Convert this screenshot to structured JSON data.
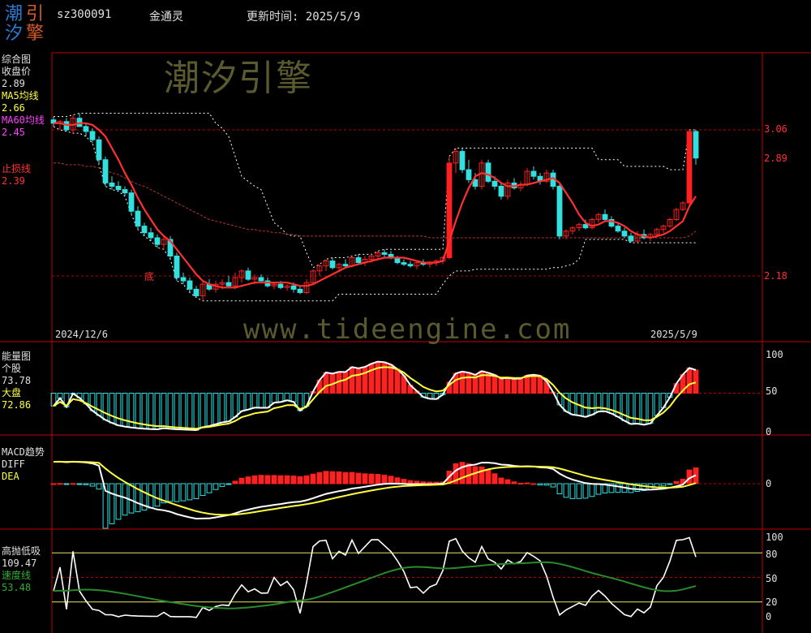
{
  "header": {
    "logo_chars": [
      "潮",
      "引",
      "汐",
      "擎"
    ],
    "code": "sz300091",
    "indicator_name": "金通灵",
    "update_label": "更新时间: 2025/5/9"
  },
  "watermarks": {
    "top": "潮汐引擎",
    "middle": "www.tideengine.com"
  },
  "colors": {
    "up": "#ff2020",
    "down": "#33e0e0",
    "border": "#c00000",
    "ma5": "#ffff40",
    "ma60": "#ff40ff",
    "stop": "#ff3030",
    "green": "#2a8a2a"
  },
  "panels": {
    "main": {
      "title": "综合图",
      "close_label": "收盘价",
      "close_value": "2.89",
      "ma5_label": "MA5均线",
      "ma5_value": "2.66",
      "ma60_label": "MA60均线",
      "ma60_value": "2.45",
      "stop_label": "止损线",
      "stop_value": "2.39",
      "bottom_marker": "底",
      "date_start": "2024/12/6",
      "date_end": "2025/5/9",
      "price_ticks": [
        "3.06",
        "2.89",
        "2.18"
      ]
    },
    "energy": {
      "title": "能量图",
      "stock_label": "个股",
      "stock_value": "73.78",
      "market_label": "大盘",
      "market_value": "72.86",
      "ticks": [
        "100",
        "50",
        "0"
      ]
    },
    "macd": {
      "title": "MACD趋势",
      "diff_label": "DIFF",
      "dea_label": "DEA",
      "ticks": [
        "0"
      ]
    },
    "tide": {
      "title": "高抛低吸",
      "value1": "109.47",
      "speed_label": "速度线",
      "value2": "53.48",
      "ticks": [
        "100",
        "80",
        "50",
        "20",
        "0"
      ]
    }
  },
  "chart_data": {
    "type": "candlestick",
    "dates_shown": [
      "2024/12/6",
      "2025/5/9"
    ],
    "candles": [
      [
        3.12,
        3.14,
        3.08,
        3.1
      ],
      [
        3.1,
        3.12,
        3.06,
        3.11
      ],
      [
        3.11,
        3.13,
        3.05,
        3.06
      ],
      [
        3.06,
        3.15,
        3.04,
        3.13
      ],
      [
        3.13,
        3.16,
        3.08,
        3.08
      ],
      [
        3.08,
        3.1,
        3.02,
        3.05
      ],
      [
        3.05,
        3.07,
        2.98,
        3.0
      ],
      [
        3.0,
        3.02,
        2.85,
        2.88
      ],
      [
        2.88,
        2.9,
        2.72,
        2.74
      ],
      [
        2.74,
        2.78,
        2.7,
        2.72
      ],
      [
        2.72,
        2.75,
        2.69,
        2.7
      ],
      [
        2.7,
        2.72,
        2.66,
        2.68
      ],
      [
        2.68,
        2.7,
        2.55,
        2.57
      ],
      [
        2.57,
        2.6,
        2.46,
        2.48
      ],
      [
        2.48,
        2.5,
        2.42,
        2.44
      ],
      [
        2.44,
        2.47,
        2.39,
        2.41
      ],
      [
        2.41,
        2.43,
        2.35,
        2.37
      ],
      [
        2.37,
        2.42,
        2.34,
        2.4
      ],
      [
        2.4,
        2.42,
        2.28,
        2.3
      ],
      [
        2.3,
        2.32,
        2.15,
        2.17
      ],
      [
        2.17,
        2.2,
        2.13,
        2.15
      ],
      [
        2.15,
        2.17,
        2.08,
        2.1
      ],
      [
        2.1,
        2.12,
        2.05,
        2.06
      ],
      [
        2.06,
        2.15,
        2.03,
        2.13
      ],
      [
        2.13,
        2.16,
        2.09,
        2.1
      ],
      [
        2.1,
        2.15,
        2.08,
        2.13
      ],
      [
        2.13,
        2.16,
        2.1,
        2.14
      ],
      [
        2.14,
        2.18,
        2.11,
        2.12
      ],
      [
        2.12,
        2.2,
        2.1,
        2.17
      ],
      [
        2.17,
        2.22,
        2.14,
        2.21
      ],
      [
        2.21,
        2.23,
        2.15,
        2.16
      ],
      [
        2.16,
        2.19,
        2.13,
        2.17
      ],
      [
        2.17,
        2.19,
        2.14,
        2.15
      ],
      [
        2.15,
        2.17,
        2.11,
        2.12
      ],
      [
        2.12,
        2.14,
        2.1,
        2.13
      ],
      [
        2.13,
        2.15,
        2.1,
        2.11
      ],
      [
        2.11,
        2.13,
        2.09,
        2.12
      ],
      [
        2.12,
        2.14,
        2.08,
        2.1
      ],
      [
        2.1,
        2.12,
        2.07,
        2.08
      ],
      [
        2.08,
        2.16,
        2.07,
        2.14
      ],
      [
        2.14,
        2.22,
        2.13,
        2.21
      ],
      [
        2.21,
        2.25,
        2.18,
        2.24
      ],
      [
        2.24,
        2.28,
        2.21,
        2.27
      ],
      [
        2.27,
        2.29,
        2.22,
        2.23
      ],
      [
        2.23,
        2.26,
        2.21,
        2.25
      ],
      [
        2.25,
        2.28,
        2.23,
        2.24
      ],
      [
        2.24,
        2.3,
        2.23,
        2.29
      ],
      [
        2.29,
        2.31,
        2.25,
        2.26
      ],
      [
        2.26,
        2.3,
        2.24,
        2.28
      ],
      [
        2.28,
        2.31,
        2.26,
        2.3
      ],
      [
        2.3,
        2.33,
        2.28,
        2.32
      ],
      [
        2.32,
        2.34,
        2.29,
        2.31
      ],
      [
        2.31,
        2.33,
        2.28,
        2.29
      ],
      [
        2.29,
        2.3,
        2.25,
        2.26
      ],
      [
        2.26,
        2.28,
        2.24,
        2.25
      ],
      [
        2.25,
        2.27,
        2.23,
        2.24
      ],
      [
        2.24,
        2.27,
        2.22,
        2.26
      ],
      [
        2.26,
        2.28,
        2.24,
        2.25
      ],
      [
        2.25,
        2.27,
        2.23,
        2.26
      ],
      [
        2.26,
        2.28,
        2.24,
        2.27
      ],
      [
        2.27,
        2.3,
        2.25,
        2.29
      ],
      [
        2.29,
        2.9,
        2.28,
        2.86
      ],
      [
        2.86,
        2.95,
        2.8,
        2.93
      ],
      [
        2.93,
        2.95,
        2.8,
        2.82
      ],
      [
        2.82,
        2.88,
        2.74,
        2.76
      ],
      [
        2.76,
        2.8,
        2.7,
        2.72
      ],
      [
        2.72,
        2.88,
        2.7,
        2.86
      ],
      [
        2.86,
        2.88,
        2.74,
        2.75
      ],
      [
        2.75,
        2.78,
        2.7,
        2.72
      ],
      [
        2.72,
        2.74,
        2.64,
        2.66
      ],
      [
        2.66,
        2.76,
        2.64,
        2.74
      ],
      [
        2.74,
        2.77,
        2.7,
        2.71
      ],
      [
        2.71,
        2.75,
        2.69,
        2.73
      ],
      [
        2.73,
        2.83,
        2.72,
        2.81
      ],
      [
        2.81,
        2.84,
        2.76,
        2.78
      ],
      [
        2.78,
        2.8,
        2.73,
        2.75
      ],
      [
        2.75,
        2.82,
        2.74,
        2.8
      ],
      [
        2.8,
        2.82,
        2.7,
        2.72
      ],
      [
        2.72,
        2.74,
        2.4,
        2.42
      ],
      [
        2.42,
        2.46,
        2.4,
        2.45
      ],
      [
        2.45,
        2.48,
        2.43,
        2.47
      ],
      [
        2.47,
        2.5,
        2.45,
        2.49
      ],
      [
        2.49,
        2.52,
        2.46,
        2.47
      ],
      [
        2.47,
        2.53,
        2.46,
        2.52
      ],
      [
        2.52,
        2.56,
        2.5,
        2.55
      ],
      [
        2.55,
        2.58,
        2.51,
        2.52
      ],
      [
        2.52,
        2.54,
        2.47,
        2.48
      ],
      [
        2.48,
        2.5,
        2.44,
        2.45
      ],
      [
        2.45,
        2.47,
        2.41,
        2.42
      ],
      [
        2.42,
        2.44,
        2.38,
        2.39
      ],
      [
        2.39,
        2.45,
        2.38,
        2.43
      ],
      [
        2.43,
        2.46,
        2.4,
        2.41
      ],
      [
        2.41,
        2.44,
        2.39,
        2.43
      ],
      [
        2.43,
        2.47,
        2.42,
        2.46
      ],
      [
        2.46,
        2.49,
        2.44,
        2.48
      ],
      [
        2.48,
        2.53,
        2.47,
        2.52
      ],
      [
        2.52,
        2.59,
        2.51,
        2.58
      ],
      [
        2.58,
        2.63,
        2.57,
        2.62
      ],
      [
        2.62,
        3.06,
        2.6,
        3.05
      ],
      [
        3.05,
        3.06,
        2.85,
        2.89
      ]
    ],
    "ma5": [
      3.1,
      3.1,
      3.09,
      3.09,
      3.1,
      3.1,
      3.09,
      3.06,
      3.02,
      2.95,
      2.88,
      2.8,
      2.73,
      2.65,
      2.58,
      2.52,
      2.46,
      2.42,
      2.39,
      2.34,
      2.29,
      2.24,
      2.19,
      2.15,
      2.13,
      2.12,
      2.11,
      2.11,
      2.11,
      2.12,
      2.13,
      2.14,
      2.14,
      2.14,
      2.14,
      2.14,
      2.14,
      2.13,
      2.12,
      2.12,
      2.13,
      2.15,
      2.17,
      2.19,
      2.21,
      2.23,
      2.24,
      2.25,
      2.26,
      2.27,
      2.28,
      2.29,
      2.29,
      2.29,
      2.29,
      2.28,
      2.27,
      2.26,
      2.26,
      2.26,
      2.27,
      2.39,
      2.51,
      2.62,
      2.71,
      2.78,
      2.8,
      2.79,
      2.77,
      2.74,
      2.72,
      2.72,
      2.73,
      2.73,
      2.74,
      2.75,
      2.76,
      2.77,
      2.74,
      2.68,
      2.62,
      2.55,
      2.5,
      2.48,
      2.49,
      2.51,
      2.51,
      2.5,
      2.48,
      2.45,
      2.43,
      2.42,
      2.41,
      2.42,
      2.43,
      2.45,
      2.48,
      2.51,
      2.6,
      2.66
    ],
    "ma60": [
      2.86,
      2.86,
      2.85,
      2.85,
      2.85,
      2.84,
      2.84,
      2.83,
      2.82,
      2.8,
      2.79,
      2.77,
      2.75,
      2.73,
      2.72,
      2.7,
      2.68,
      2.66,
      2.64,
      2.62,
      2.6,
      2.58,
      2.56,
      2.54,
      2.52,
      2.51,
      2.5,
      2.49,
      2.48,
      2.47,
      2.46,
      2.46,
      2.45,
      2.45,
      2.44,
      2.44,
      2.43,
      2.43,
      2.42,
      2.42,
      2.42,
      2.42,
      2.42,
      2.42,
      2.42,
      2.42,
      2.42,
      2.42,
      2.42,
      2.42,
      2.42,
      2.42,
      2.42,
      2.42,
      2.42,
      2.42,
      2.42,
      2.42,
      2.41,
      2.41,
      2.41,
      2.41,
      2.41,
      2.41,
      2.41,
      2.41,
      2.41,
      2.41,
      2.41,
      2.41,
      2.41,
      2.41,
      2.41,
      2.41,
      2.41,
      2.41,
      2.41,
      2.41,
      2.41,
      2.41,
      2.41,
      2.41,
      2.41,
      2.41,
      2.41,
      2.41,
      2.41,
      2.41,
      2.41,
      2.41,
      2.41,
      2.41,
      2.41,
      2.41,
      2.41,
      2.41,
      2.41,
      2.41,
      2.42,
      2.45
    ]
  }
}
